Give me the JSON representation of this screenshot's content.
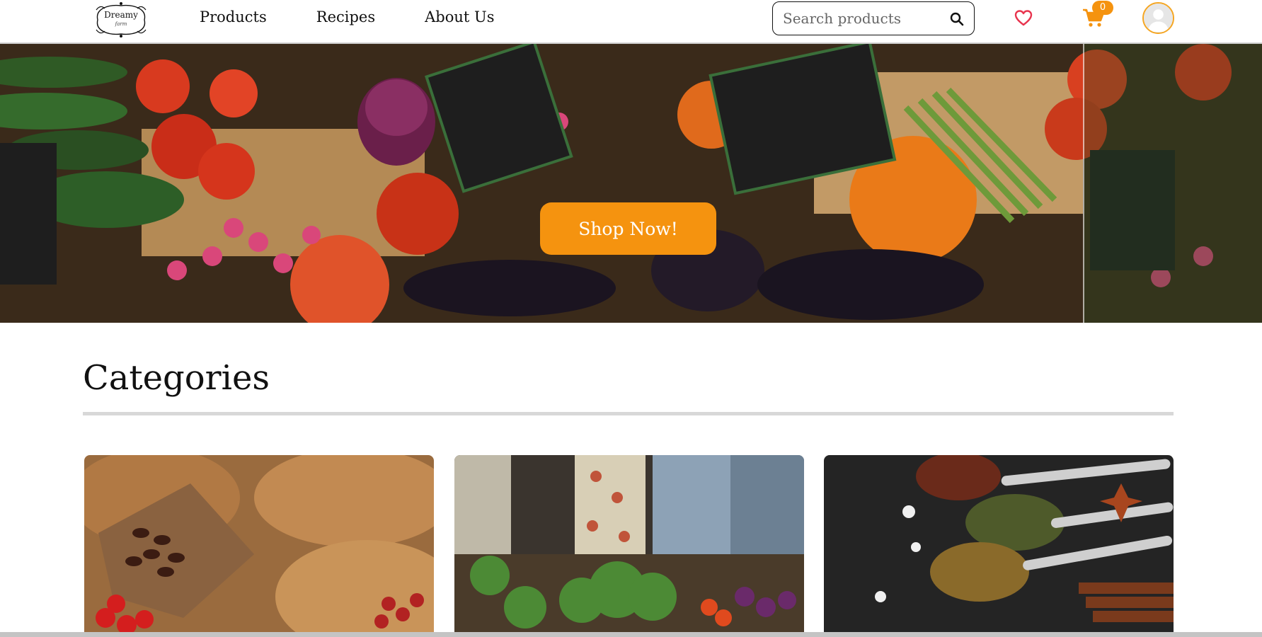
{
  "brand": {
    "name": "Dreamy",
    "tagline": "farm"
  },
  "nav": {
    "items": [
      {
        "label": "Products"
      },
      {
        "label": "Recipes"
      },
      {
        "label": "About Us"
      }
    ]
  },
  "search": {
    "placeholder": "Search products",
    "value": ""
  },
  "cart": {
    "count": "0"
  },
  "hero": {
    "cta_label": "Shop Now!"
  },
  "categories": {
    "title": "Categories",
    "cards": [
      {
        "image": "baskets-dates-strawberries"
      },
      {
        "image": "vegetable-market-stall"
      },
      {
        "image": "spices-on-spoons"
      }
    ]
  },
  "colors": {
    "accent": "#f5930f",
    "heart": "#e8344e",
    "rule": "#d8d8d8"
  }
}
